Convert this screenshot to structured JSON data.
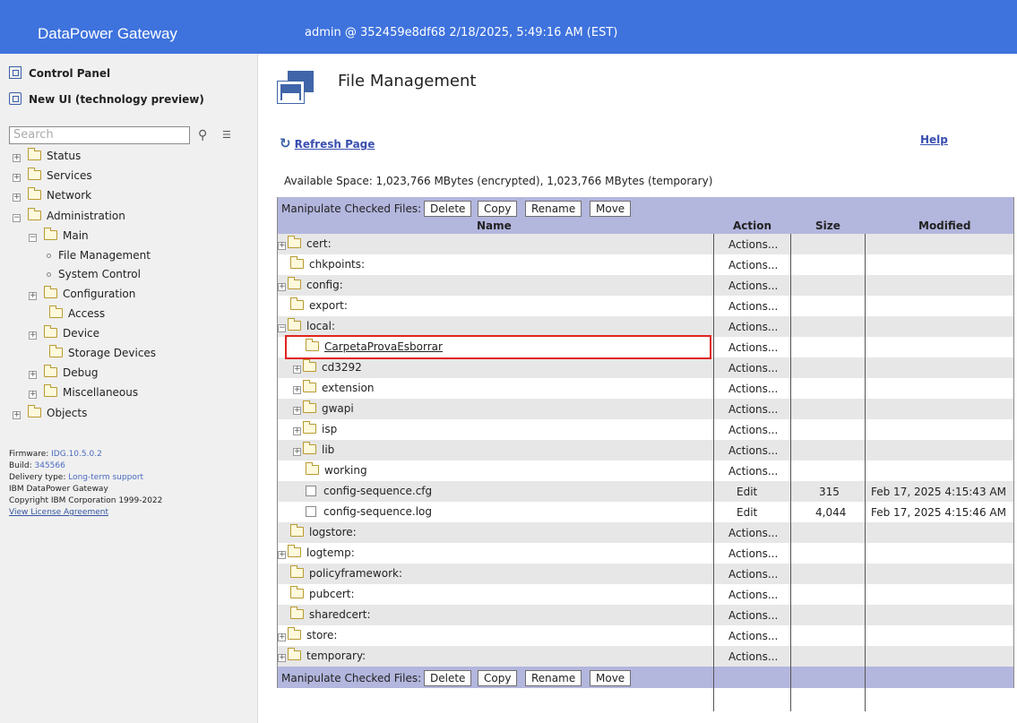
{
  "banner": {
    "brand": "DataPower Gateway",
    "user": "admin @ 352459e8df68 2/18/2025, 5:49:16 AM (EST)"
  },
  "nav": {
    "control_panel": "Control Panel",
    "new_ui": "New UI (technology preview)",
    "search_placeholder": "Search",
    "items": [
      {
        "label": "Status"
      },
      {
        "label": "Services"
      },
      {
        "label": "Network"
      },
      {
        "label": "Administration"
      },
      {
        "label": "Main"
      },
      {
        "label": "File Management"
      },
      {
        "label": "System Control"
      },
      {
        "label": "Configuration"
      },
      {
        "label": "Access"
      },
      {
        "label": "Device"
      },
      {
        "label": "Storage Devices"
      },
      {
        "label": "Debug"
      },
      {
        "label": "Miscellaneous"
      },
      {
        "label": "Objects"
      }
    ],
    "info": {
      "firmware_label": "Firmware:",
      "firmware": "IDG.10.5.0.2",
      "build_label": "Build:",
      "build": "345566",
      "delivery_label": "Delivery type:",
      "delivery": "Long-term support",
      "product": "IBM DataPower Gateway",
      "copyright": "Copyright IBM Corporation 1999-2022",
      "license": "View License Agreement"
    }
  },
  "page": {
    "title": "File Management",
    "refresh": "Refresh Page",
    "help": "Help",
    "available": "Available Space: 1,023,766 MBytes (encrypted), 1,023,766 MBytes (temporary)"
  },
  "table": {
    "manipulate_label": "Manipulate Checked Files:",
    "buttons": [
      "Delete",
      "Copy",
      "Rename",
      "Move"
    ],
    "columns": {
      "name": "Name",
      "action": "Action",
      "size": "Size",
      "modified": "Modified"
    },
    "rows": [
      {
        "name": "cert:",
        "action": "Actions..."
      },
      {
        "name": "chkpoints:",
        "action": "Actions..."
      },
      {
        "name": "config:",
        "action": "Actions..."
      },
      {
        "name": "export:",
        "action": "Actions..."
      },
      {
        "name": "local:",
        "action": "Actions..."
      },
      {
        "name": "CarpetaProvaEsborrar",
        "action": "Actions..."
      },
      {
        "name": "cd3292",
        "action": "Actions..."
      },
      {
        "name": "extension",
        "action": "Actions..."
      },
      {
        "name": "gwapi",
        "action": "Actions..."
      },
      {
        "name": "isp",
        "action": "Actions..."
      },
      {
        "name": "lib",
        "action": "Actions..."
      },
      {
        "name": "working",
        "action": "Actions..."
      },
      {
        "name": "config-sequence.cfg",
        "action": "Edit",
        "size": "315",
        "modified": "Feb 17, 2025 4:15:43 AM"
      },
      {
        "name": "config-sequence.log",
        "action": "Edit",
        "size": "4,044",
        "modified": "Feb 17, 2025 4:15:46 AM"
      },
      {
        "name": "logstore:",
        "action": "Actions..."
      },
      {
        "name": "logtemp:",
        "action": "Actions..."
      },
      {
        "name": "policyframework:",
        "action": "Actions..."
      },
      {
        "name": "pubcert:",
        "action": "Actions..."
      },
      {
        "name": "sharedcert:",
        "action": "Actions..."
      },
      {
        "name": "store:",
        "action": "Actions..."
      },
      {
        "name": "temporary:",
        "action": "Actions..."
      }
    ]
  }
}
